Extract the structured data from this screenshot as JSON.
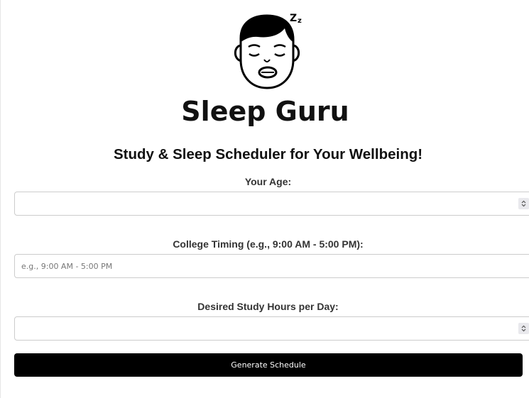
{
  "brand": {
    "logo_icon": "sleeping-face-icon",
    "name": "Sleep Guru"
  },
  "heading": "Study & Sleep Scheduler for Your Wellbeing!",
  "form": {
    "age": {
      "label": "Your Age:",
      "value": "",
      "placeholder": "",
      "spinner_icon": "number-spinner-icon"
    },
    "college_timing": {
      "label": "College Timing (e.g., 9:00 AM - 5:00 PM):",
      "value": "",
      "placeholder": "e.g., 9:00 AM - 5:00 PM"
    },
    "study_hours": {
      "label": "Desired Study Hours per Day:",
      "value": "",
      "placeholder": "",
      "spinner_icon": "number-spinner-icon"
    },
    "submit_label": "Generate Schedule"
  },
  "colors": {
    "button_background": "#000000",
    "button_text": "#ffffff",
    "text": "#111111"
  }
}
